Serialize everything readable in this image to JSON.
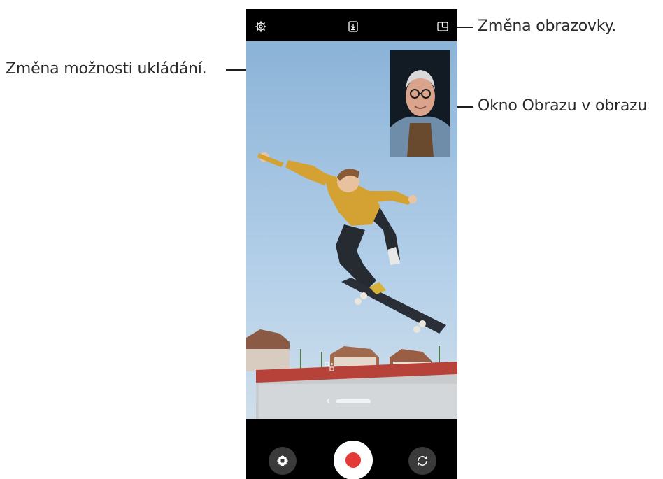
{
  "callouts": {
    "change_screen": "Změna obrazovky.",
    "change_save_options": "Změna možnosti ukládání.",
    "pip_window": "Okno Obrazu v obrazu"
  },
  "camera": {
    "top_bar_icons": [
      "settings-icon",
      "save-option-icon",
      "screen-layout-icon"
    ],
    "hint_chevron": "‹",
    "hint_text_blurred": "",
    "bottom_bar_icons": [
      "effects-icon",
      "record-button",
      "switch-camera-icon"
    ]
  },
  "colors": {
    "record_red": "#e53935",
    "callout_line": "#1d1d1d",
    "phone_bg": "#000000",
    "sky_top": "#8db4d8",
    "sky_bottom": "#c9dbe8"
  }
}
